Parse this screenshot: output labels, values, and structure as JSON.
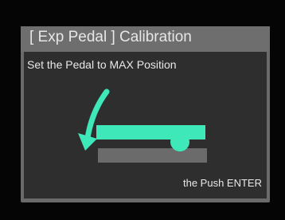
{
  "dialog": {
    "title": "[ Exp Pedal ] Calibration",
    "instruction": "Set the Pedal to MAX Position",
    "footer": "the Push ENTER"
  },
  "illustration": {
    "arrow_icon": "curved-down-arrow-icon",
    "pedal_icon": "expression-pedal-icon",
    "accent_color": "#3ee8b8",
    "base_color": "#6b6b6b"
  }
}
